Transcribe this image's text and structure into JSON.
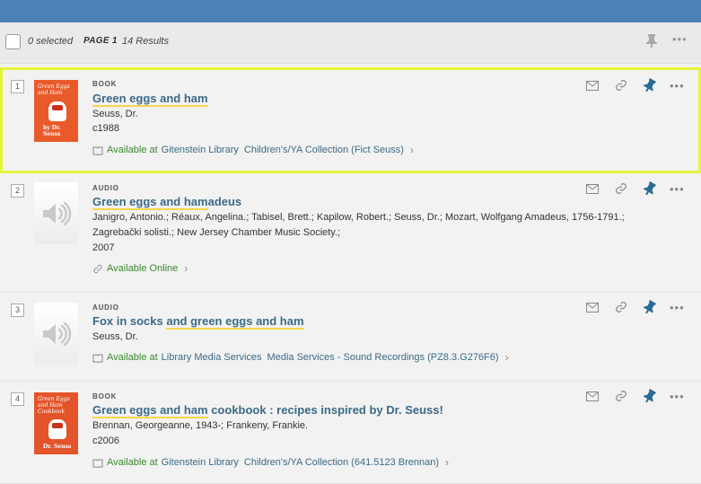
{
  "toolbar": {
    "selected_text": "0 selected",
    "page_text": "PAGE 1",
    "results_text": "14 Results"
  },
  "colors": {
    "header": "#4a82b5",
    "available": "#3b8a2e",
    "link": "#3b6a86",
    "highlight": "#f5d74a",
    "selected_border": "#e4f53a"
  },
  "items": [
    {
      "num": "1",
      "type": "BOOK",
      "title_hl": "Green eggs and ham",
      "title_rest": "",
      "line1": "Seuss, Dr.",
      "line2": "c1988",
      "status": "Available at",
      "library": "Gitenstein Library",
      "location": "Children's/YA Collection (Fict Seuss)",
      "cover_title": "Green Eggs and Ham",
      "cover_author": "by Dr. Seuss"
    },
    {
      "num": "2",
      "type": "AUDIO",
      "title_hl": "Green eggs and ham",
      "title_rest": "adeus",
      "line1": "Janigro, Antonio.; Réaux, Angelina.; Tabisel, Brett.; Kapilow, Robert.; Seuss, Dr.; Mozart, Wolfgang Amadeus, 1756-1791.;",
      "line2": "Zagrebački solisti.; New Jersey Chamber Music Society.;",
      "line3": "2007",
      "status": "Available Online"
    },
    {
      "num": "3",
      "type": "AUDIO",
      "title_pre": "Fox in socks ",
      "title_hl": "and green eggs and ham",
      "line1": "Seuss, Dr.",
      "status": "Available at",
      "library": "Library Media Services",
      "location": "Media Services - Sound Recordings (PZ8.3.G276F6)"
    },
    {
      "num": "4",
      "type": "BOOK",
      "title_hl": "Green eggs and ham",
      "title_rest": " cookbook : recipes inspired by Dr. Seuss!",
      "line1": "Brennan, Georgeanne, 1943-; Frankeny, Frankie.",
      "line2": "c2006",
      "status": "Available at",
      "library": "Gitenstein Library",
      "location": "Children's/YA Collection (641.5123 Brennan)",
      "cover_title": "Green Eggs and Ham Cookbook",
      "cover_author": "Dr. Seuss"
    }
  ]
}
